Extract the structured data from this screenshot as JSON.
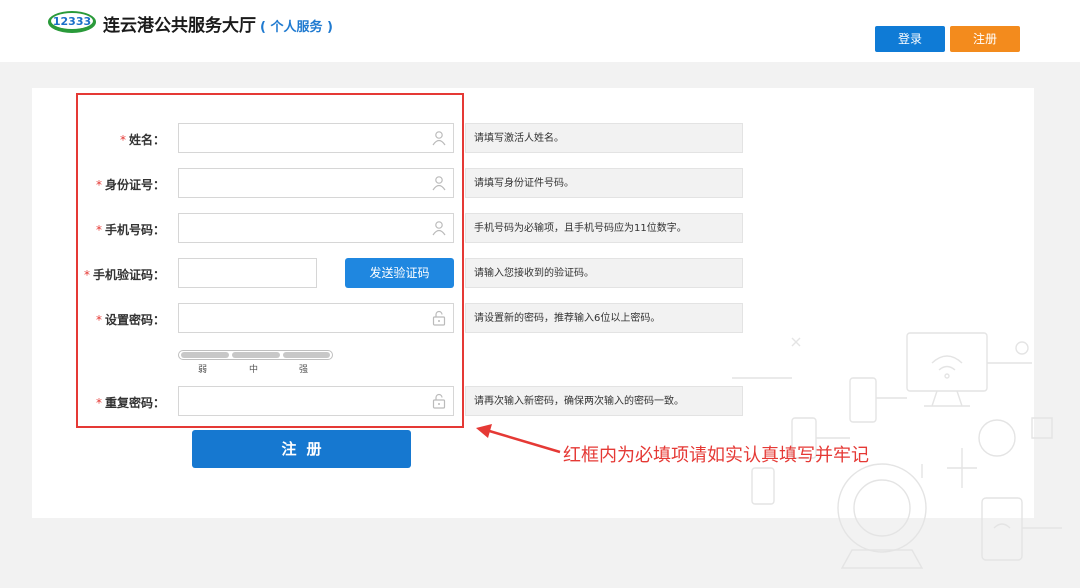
{
  "header": {
    "site_title": "连云港公共服务大厅",
    "site_subtitle": "( 个人服务 )",
    "login_label": "登录",
    "register_label": "注册",
    "colors": {
      "login_bg": "#0f7bd6",
      "register_bg": "#f38b1d"
    }
  },
  "form": {
    "required_mark": "*",
    "rows": [
      {
        "label": "姓名：",
        "icon": "user-icon",
        "hint": "请填写激活人姓名。"
      },
      {
        "label": "身份证号：",
        "icon": "user-icon",
        "hint": "请填写身份证件号码。"
      },
      {
        "label": "手机号码：",
        "icon": "user-icon",
        "hint": "手机号码为必输项，且手机号码应为11位数字。"
      },
      {
        "label": "手机验证码：",
        "hint": "请输入您接收到的验证码。"
      },
      {
        "label": "设置密码：",
        "icon": "lock-icon",
        "hint": "请设置新的密码，推荐输入6位以上密码。"
      },
      {
        "label": "重复密码：",
        "icon": "lock-icon",
        "hint": "请再次输入新密码，确保两次输入的密码一致。"
      }
    ],
    "send_code_label": "发送验证码",
    "strength": {
      "weak": "弱",
      "medium": "中",
      "strong": "强"
    },
    "submit_label": "注册"
  },
  "annotation": {
    "text": "红框内为必填项请如实认真填写并牢记",
    "color": "#e53935"
  }
}
